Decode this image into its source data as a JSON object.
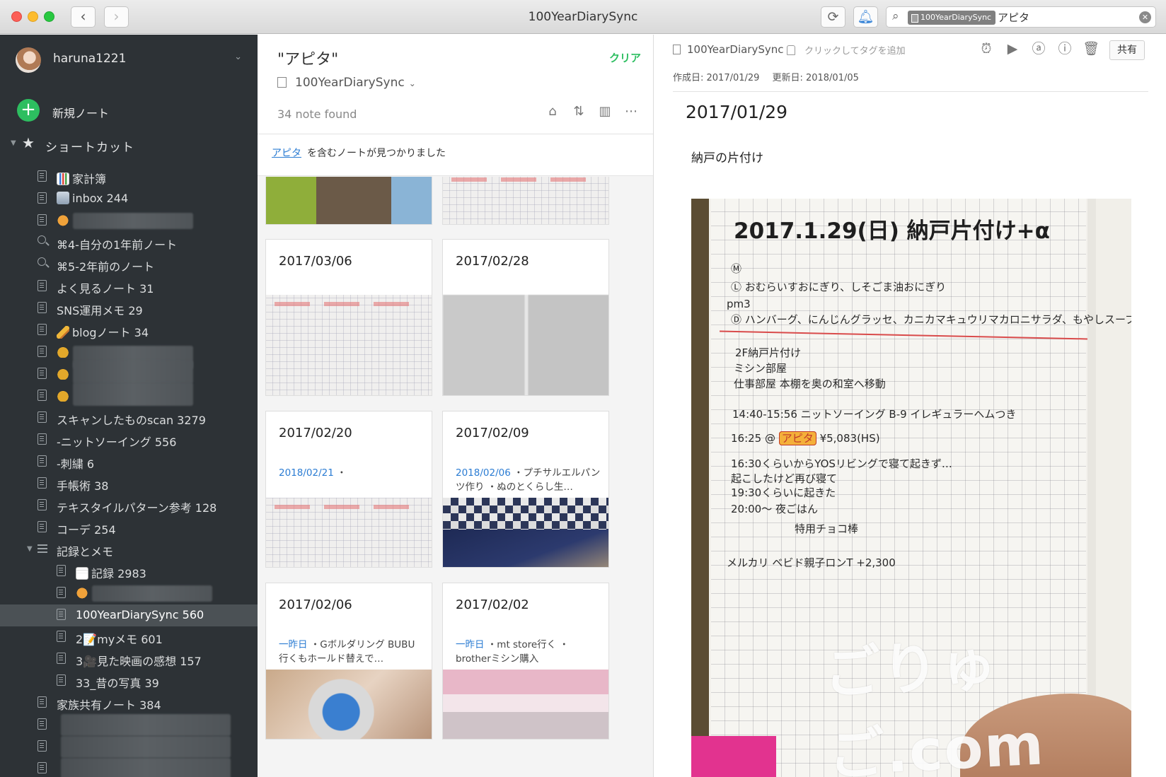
{
  "window": {
    "title": "100YearDiarySync"
  },
  "search": {
    "scope": "100YearDiarySync",
    "query": "アピタ"
  },
  "sidebar": {
    "username": "haruna1221",
    "new_note_label": "新規ノート",
    "shortcuts_label": "ショートカット",
    "items": [
      {
        "label": "家計簿",
        "icon": "notebook-icon",
        "emoji": "chart"
      },
      {
        "label": "inbox 244",
        "icon": "notebook-icon",
        "emoji": "inbox"
      },
      {
        "label": "",
        "icon": "notebook-icon",
        "emoji": "cat",
        "blurred": true
      },
      {
        "label": "⌘4-自分の1年前ノート",
        "icon": "search-icon"
      },
      {
        "label": "⌘5-2年前のノート",
        "icon": "search-icon"
      },
      {
        "label": "よく見るノート 31",
        "icon": "notebook-icon"
      },
      {
        "label": "SNS運用メモ 29",
        "icon": "notebook-icon"
      },
      {
        "label": "blogノート 34",
        "icon": "notebook-icon",
        "emoji": "pencil"
      },
      {
        "label": "",
        "icon": "notebook-icon",
        "emoji": "bag",
        "blurred": true
      },
      {
        "label": "",
        "icon": "notebook-icon",
        "emoji": "bag",
        "blurred": true
      },
      {
        "label": "",
        "icon": "notebook-icon",
        "emoji": "bag",
        "blurred": true
      },
      {
        "label": "スキャンしたものscan 3279",
        "icon": "notebook-icon"
      },
      {
        "label": "-ニットソーイング 556",
        "icon": "notebook-icon"
      },
      {
        "label": "-刺繍 6",
        "icon": "notebook-icon"
      },
      {
        "label": "手帳術 38",
        "icon": "notebook-icon"
      },
      {
        "label": "テキスタイルパターン参考 128",
        "icon": "notebook-icon"
      },
      {
        "label": "コーデ 254",
        "icon": "notebook-icon"
      },
      {
        "label": "記録とメモ",
        "icon": "stack-icon",
        "expanded": true
      },
      {
        "label": "記録 2983",
        "icon": "notebook-icon",
        "emoji": "memo",
        "indent": true
      },
      {
        "label": "",
        "icon": "notebook-icon",
        "emoji": "cat",
        "indent": true,
        "blurred": true
      },
      {
        "label": "100YearDiarySync 560",
        "icon": "notebook-icon",
        "indent": true,
        "selected": true
      },
      {
        "label": "2📝myメモ 601",
        "icon": "notebook-icon",
        "indent": true
      },
      {
        "label": "3🎥見た映画の感想 157",
        "icon": "notebook-icon",
        "indent": true
      },
      {
        "label": "33_昔の写真 39",
        "icon": "notebook-icon",
        "indent": true
      },
      {
        "label": "家族共有ノート 384",
        "icon": "notebook-icon"
      },
      {
        "label": "",
        "icon": "notebook-icon",
        "blurred": true
      },
      {
        "label": "",
        "icon": "notebook-icon",
        "blurred": true
      },
      {
        "label": "",
        "icon": "notebook-icon",
        "blurred": true
      }
    ]
  },
  "notelist": {
    "title": "\"アピタ\"",
    "clear_label": "クリア",
    "notebook": "100YearDiarySync",
    "count": "34 note found",
    "banner_query": "アピタ",
    "banner_rest": "を含むノートが見つかりました",
    "cards": [
      {
        "date": "",
        "snippet_link": "",
        "snippet": "",
        "thumb": "child"
      },
      {
        "date": "",
        "snippet_link": "",
        "snippet": "",
        "thumb": "notebook"
      },
      {
        "date": "2017/03/06",
        "snippet_link": "",
        "snippet": "",
        "thumb": "notebook"
      },
      {
        "date": "2017/02/28",
        "snippet_link": "",
        "snippet": "",
        "thumb": "blur"
      },
      {
        "date": "2017/02/20",
        "snippet_link": "2018/02/21",
        "snippet": " ・",
        "thumb": "notebook"
      },
      {
        "date": "2017/02/09",
        "snippet_link": "2018/02/06",
        "snippet": " ・プチサルエルパンツ作り ・ぬのとくらし生…",
        "thumb": "cloth"
      },
      {
        "date": "2017/02/06",
        "snippet_link": "一昨日",
        "snippet": " ・Gボルダリング BUBU行くもホールド替えで…",
        "thumb": "ipad"
      },
      {
        "date": "2017/02/02",
        "snippet_link": "一昨日",
        "snippet": " ・mt store行く ・ brotherミシン購入",
        "thumb": "store"
      }
    ]
  },
  "editor": {
    "notebook": "100YearDiarySync",
    "tag_placeholder": "クリックしてタグを追加",
    "share_label": "共有",
    "created": "作成日: 2017/01/29",
    "updated": "更新日: 2018/01/05",
    "title": "2017/01/29",
    "body": "納戸の片付け",
    "photo": {
      "heading": "2017.1.29(日) 納戸片付け+α",
      "lines": [
        "Ⓜ",
        "Ⓛ おむらいすおにぎり、しそごま油おにぎり",
        "pm3",
        "Ⓓ ハンバーグ、にんじんグラッセ、カニカマキュウリマカロニサラダ、もやしスープ",
        "2F納戸片付け",
        "ミシン部屋",
        "仕事部屋 本棚を奥の和室へ移動",
        "14:40-15:56 ニットソーイング B-9 イレギュラーヘムつき",
        "16:25 @",
        "アピタ",
        "¥5,083(HS)",
        "16:30くらいからYOSリビングで寝て起きず…",
        "起こしたけど再び寝て",
        "19:30くらいに起きた",
        "20:00〜  夜ごはん",
        "特用チョコ棒",
        "メルカリ ベビド親子ロンT +2,300"
      ],
      "watermark": "ごりゅご.com"
    }
  }
}
